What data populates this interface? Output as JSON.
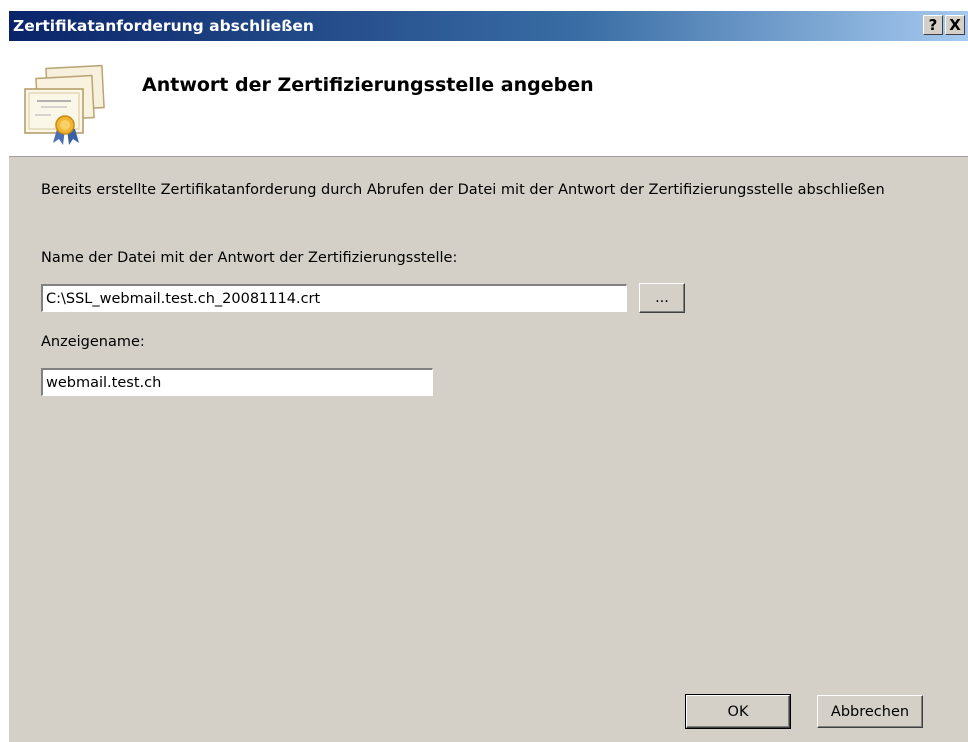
{
  "window": {
    "title": "Zertifikatanforderung abschließen",
    "help_button": "?",
    "close_button": "X"
  },
  "banner": {
    "heading": "Antwort der Zertifizierungsstelle angeben",
    "icon": "certificate-icon"
  },
  "main": {
    "description": "Bereits erstellte Zertifikatanforderung durch Abrufen der Datei mit der Antwort der Zertifizierungsstelle abschließen",
    "file_label": "Name der Datei mit der Antwort der Zertifizierungsstelle:",
    "file_value": "C:\\SSL_webmail.test.ch_20081114.crt",
    "browse_label": "...",
    "friendly_label": "Anzeigename:",
    "friendly_value": "webmail.test.ch"
  },
  "footer": {
    "ok_label": "OK",
    "cancel_label": "Abbrechen"
  },
  "colors": {
    "dialog_bg": "#d4d0c8",
    "titlebar_start": "#0a246a",
    "titlebar_end": "#a6caf0"
  }
}
